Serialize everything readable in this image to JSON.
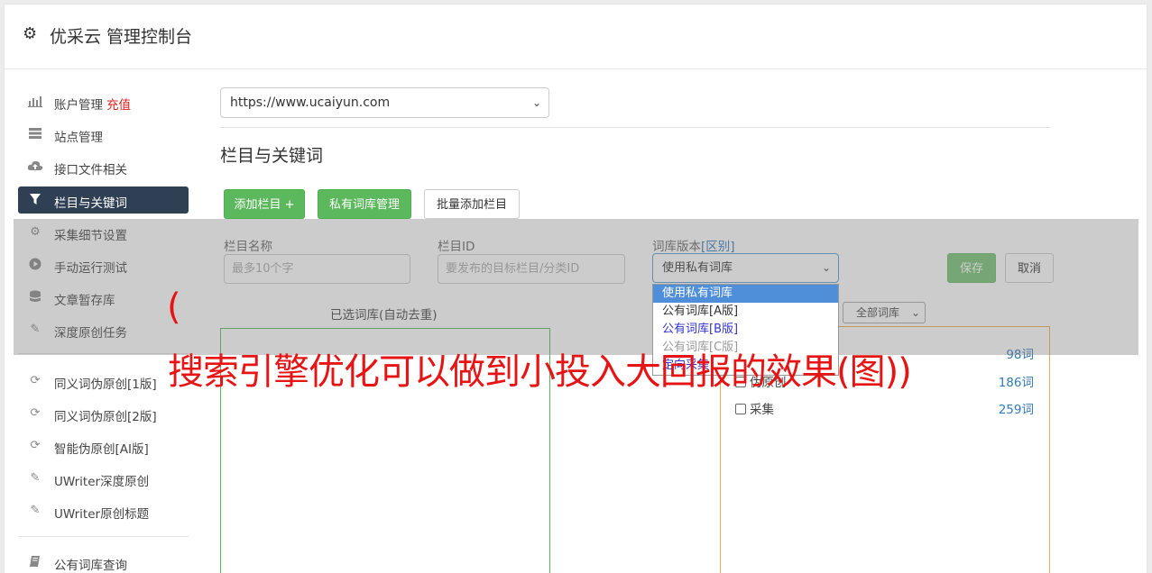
{
  "header": {
    "title": "优采云 管理控制台",
    "icon": "gear-icon"
  },
  "sidebar": {
    "items": [
      {
        "label": "账户管理",
        "badge": "充值",
        "icon": "bar-chart-icon"
      },
      {
        "label": "站点管理",
        "icon": "server-icon"
      },
      {
        "label": "接口文件相关",
        "icon": "cloud-upload-icon"
      },
      {
        "label": "栏目与关键词",
        "icon": "filter-icon",
        "active": true
      },
      {
        "label": "采集细节设置",
        "icon": "cogs-icon"
      },
      {
        "label": "手动运行测试",
        "icon": "play-circle-icon"
      },
      {
        "label": "文章暂存库",
        "icon": "database-icon"
      },
      {
        "label": "深度原创任务",
        "icon": "edit-icon"
      },
      {
        "label": "同义词伪原创[1版]",
        "icon": "refresh-icon"
      },
      {
        "label": "同义词伪原创[2版]",
        "icon": "refresh-icon"
      },
      {
        "label": "智能伪原创[AI版]",
        "icon": "refresh-icon"
      },
      {
        "label": "UWriter深度原创",
        "icon": "edit-icon"
      },
      {
        "label": "UWriter原创标题",
        "icon": "edit-icon"
      },
      {
        "label": "公有词库查询",
        "icon": "book-icon"
      }
    ]
  },
  "main": {
    "site_select": "https://www.ucaiyun.com",
    "section_title": "栏目与关键词",
    "buttons": {
      "add_column": "添加栏目 +",
      "private_lib": "私有词库管理",
      "batch_add": "批量添加栏目"
    },
    "form": {
      "name_label": "栏目名称",
      "name_placeholder": "最多10个字",
      "id_label": "栏目ID",
      "id_placeholder": "要发布的目标栏目/分类ID",
      "version_label": "词库版本",
      "version_link": "[区别]",
      "version_value": "使用私有词库",
      "save": "保存",
      "cancel": "取消"
    },
    "dropdown_options": [
      "使用私有词库",
      "公有词库[A版]",
      "公有词库[B版]",
      "公有词库[C版]",
      "定向采集"
    ],
    "selected_panel_title": "已选词库(自动去重)",
    "lib_filter": "全部词库",
    "libraries": [
      {
        "name": "",
        "count": "98词"
      },
      {
        "name": "伪原创",
        "count": "186词"
      },
      {
        "name": "采集",
        "count": "259词"
      }
    ]
  },
  "watermark": {
    "line1": "(",
    "line2": "搜索引擎优化可以做到小投入大回报的效果(图))"
  },
  "colors": {
    "accent_green": "#5cb85c",
    "active_nav": "#2f4055",
    "link_blue": "#337ab7",
    "watermark_red": "#e61414"
  }
}
